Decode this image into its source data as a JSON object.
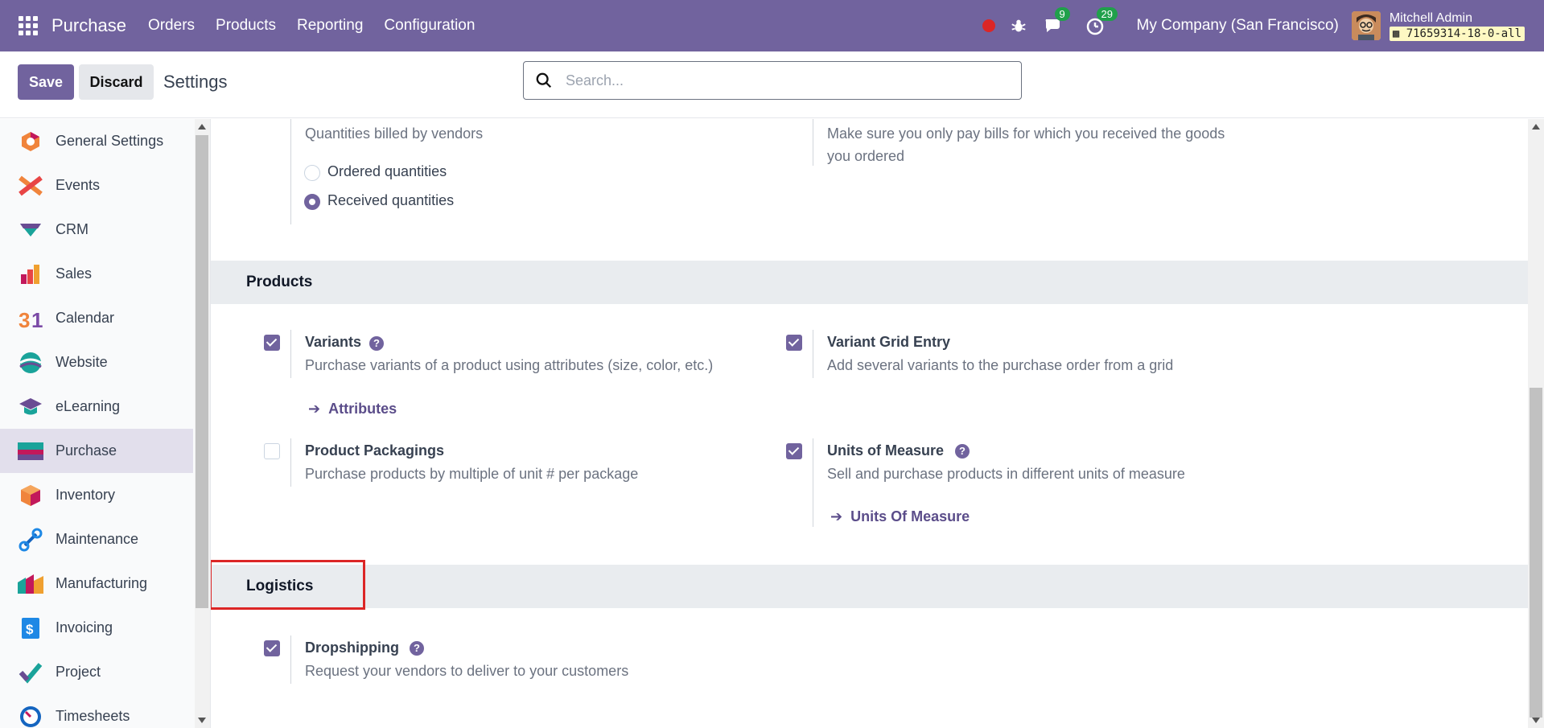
{
  "navbar": {
    "brand": "Purchase",
    "menu": [
      "Orders",
      "Products",
      "Reporting",
      "Configuration"
    ],
    "messages_count": "9",
    "activities_count": "29",
    "company": "My Company (San Francisco)",
    "user_name": "Mitchell Admin",
    "db_tag": "71659314-18-0-all"
  },
  "control": {
    "save_label": "Save",
    "discard_label": "Discard",
    "title": "Settings",
    "search_placeholder": "Search..."
  },
  "sidebar": {
    "items": [
      {
        "label": "General Settings",
        "icon": "general-settings-icon"
      },
      {
        "label": "Events",
        "icon": "events-icon"
      },
      {
        "label": "CRM",
        "icon": "crm-icon"
      },
      {
        "label": "Sales",
        "icon": "sales-icon"
      },
      {
        "label": "Calendar",
        "icon": "calendar-icon"
      },
      {
        "label": "Website",
        "icon": "website-icon"
      },
      {
        "label": "eLearning",
        "icon": "elearning-icon"
      },
      {
        "label": "Purchase",
        "icon": "purchase-icon",
        "active": true
      },
      {
        "label": "Inventory",
        "icon": "inventory-icon"
      },
      {
        "label": "Maintenance",
        "icon": "maintenance-icon"
      },
      {
        "label": "Manufacturing",
        "icon": "manufacturing-icon"
      },
      {
        "label": "Invoicing",
        "icon": "invoicing-icon"
      },
      {
        "label": "Project",
        "icon": "project-icon"
      },
      {
        "label": "Timesheets",
        "icon": "timesheets-icon"
      }
    ]
  },
  "billing": {
    "desc": "Quantities billed by vendors",
    "options": [
      "Ordered quantities",
      "Received quantities"
    ],
    "selected": "Received quantities",
    "right_desc_line1": "Make sure you only pay bills for which you received the goods",
    "right_desc_line2": "you ordered"
  },
  "products": {
    "title": "Products",
    "variants": {
      "title": "Variants",
      "desc": "Purchase variants of a product using attributes (size, color, etc.)",
      "link": "Attributes",
      "checked": true
    },
    "variant_grid": {
      "title": "Variant Grid Entry",
      "desc": "Add several variants to the purchase order from a grid",
      "checked": true
    },
    "packagings": {
      "title": "Product Packagings",
      "desc": "Purchase products by multiple of unit # per package",
      "checked": false
    },
    "uom": {
      "title": "Units of Measure",
      "desc": "Sell and purchase products in different units of measure",
      "link": "Units Of Measure",
      "checked": true
    }
  },
  "logistics": {
    "title": "Logistics",
    "dropshipping": {
      "title": "Dropshipping",
      "desc": "Request your vendors to deliver to your customers",
      "checked": true
    }
  },
  "colors": {
    "brand": "#71639e",
    "highlight": "#dc2626"
  }
}
